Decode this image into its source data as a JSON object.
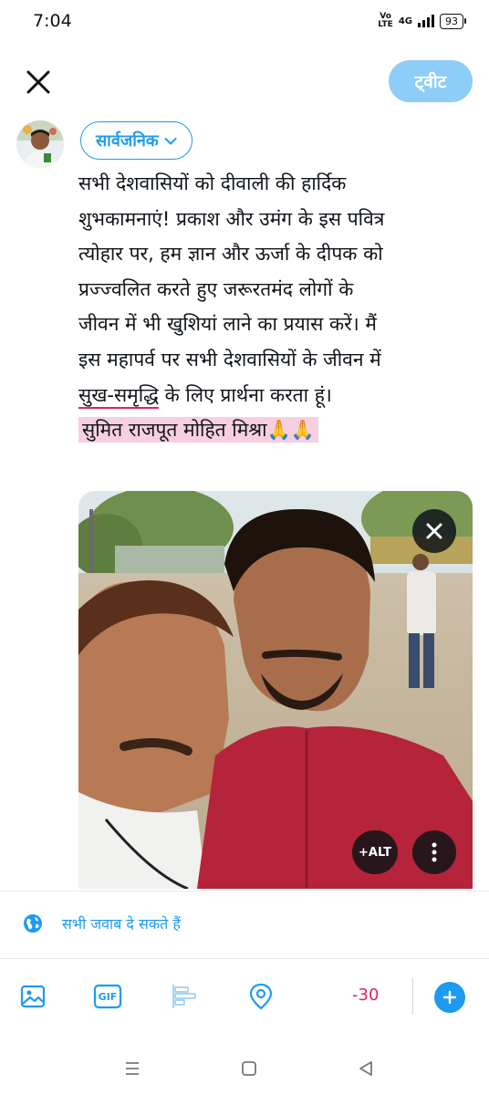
{
  "status_bar": {
    "time": "7:04",
    "volte_top": "Vo",
    "volte_bottom": "LTE",
    "network": "4G",
    "battery": "93"
  },
  "header": {
    "tweet_button": "ट्वीट"
  },
  "audience": {
    "label": "सार्वजनिक"
  },
  "compose": {
    "lines": [
      "सभी देशवासियों को दीवाली की हार्दिक",
      "शुभकामनाएं! प्रकाश और उमंग के इस पवित्र",
      "त्योहार पर, हम ज्ञान और ऊर्जा के दीपक को",
      "प्रज्ज्वलित करते हुए जरूरतमंद लोगों के",
      "जीवन में भी खुशियां लाने का प्रयास करें। मैं",
      "इस महापर्व पर सभी देशवासियों के जीवन में"
    ],
    "line7_underlined": "सुख-समृद्धि",
    "line7_rest": " के लिए प्रार्थना करता हूं।",
    "line8_highlighted": "सुमित राजपूत मोहित मिश्रा🙏🙏"
  },
  "media": {
    "alt_label": "+ALT"
  },
  "reply_setting": {
    "label": "सभी जवाब दे सकते हैं"
  },
  "toolbar": {
    "gif_label": "GIF",
    "char_counter": "-30"
  },
  "colors": {
    "accent": "#1d9bf0",
    "tweet_button_disabled": "#8ecdf7",
    "counter_over_limit": "#e0245e",
    "highlight": "#f7cfe0"
  },
  "icons": {
    "close": "close-icon",
    "chevron": "chevron-down-icon",
    "globe": "globe-icon",
    "image": "image-icon",
    "gif": "gif-icon",
    "poll": "poll-icon",
    "location": "location-icon",
    "plus": "plus-icon",
    "more": "more-vertical-icon"
  }
}
